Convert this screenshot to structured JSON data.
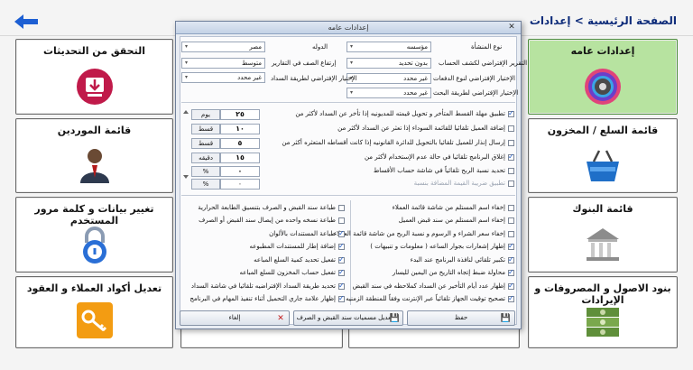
{
  "header": {
    "breadcrumb": "الصفحة الرئيسية > إعدادات"
  },
  "tiles": {
    "updates": "التحقق من التحديثات",
    "general": "إعدادات عامه",
    "suppliers": "قائمة الموردين",
    "goods": "قائمة السلع / المخزون",
    "user": "تغيير بيانات و كلمة مرور المستخدم",
    "banks": "قائمة البنوك",
    "codes": "تعديل أكواد العملاء و العقود",
    "assets": "بنود الاصول و المصروفات و الإيرادات"
  },
  "dialog": {
    "title": "إعدادات عامه",
    "fields": {
      "entity_type_label": "نوع المنشأة",
      "entity_type_value": "مؤسسه",
      "country_label": "الدوله",
      "country_value": "مصر",
      "default_report_label": "التقرير الإفتراضي لكشف الحساب",
      "default_report_value": "بدون تحديد",
      "row_height_label": "إرتفاع الصف في التقارير",
      "row_height_value": "متوسط",
      "payment_type_label": "الإختيار الإفتراضي لنوع الدفعات",
      "payment_type_value": "غير محدد",
      "payment_method_label": "الإختيار الإفتراضي لطريقة السداد",
      "payment_method_value": "غير محدد",
      "search_method_label": "الإختيار الإفتراضي لطريقة البحث",
      "search_method_value": "غير محدد"
    },
    "options_top": [
      {
        "label": "تطبيق مهلة القسط المتأخر و تحويل قيمته للمديونيه إذا تأخر عن السداد لأكثر من",
        "value": "٢٥",
        "unit": "يوم"
      },
      {
        "label": "إضافة العميل تلقائيا للقائمة السوداء إذا تعثر عن السداد لأكثر من",
        "value": "١٠",
        "unit": "قسط"
      },
      {
        "label": "إرسال إنذار للعميل تلقائيا بالتحويل للدائرة القانونيه إذا كانت أقساطه المتعثره أكثر من",
        "value": "٥",
        "unit": "قسط"
      },
      {
        "label": "إغلاق البرنامج تلقائيا في حالة عدم الإستخدام لأكثر من",
        "value": "١٥",
        "unit": "دقيقه"
      },
      {
        "label": "تحديد نسبة الربح تلقائياً في شاشة حساب الأقساط",
        "value": "٠",
        "unit": "%"
      },
      {
        "label": "تطبيق ضريبة القيمة المضافة بنسبة",
        "value": "٠",
        "unit": "%"
      }
    ],
    "options_left": [
      "طباعة سند القبض و الصرف بتنسيق الطابعة الحرارية",
      "طباعة نسخه واحده من إيصال سند القبض أو الصرف",
      "طباعة المستندات بالألوان",
      "إضافة إطار للمستندات المطبوعه",
      "تفعيل تحديد كمية السلع المباعه",
      "تفعيل حساب المخزون للسلع المباعه",
      "تحديد طريقة السداد الإفتراضيه تلقائيا في شاشة السداد",
      "إظهار علامة جاري التحميل أثناء تنفيذ المهام في البرنامج"
    ],
    "options_right": [
      "إخفاء اسم المستلم من شاشة قائمة العملاء",
      "إخفاء اسم المستلم من سند قبض العميل",
      "إخفاء سعر الشراء و الرسوم و نسبة الربح من شاشة قائمة العملاء",
      "إظهار إشعارات بجوار الساعه ( معلومات و تنبيهات )",
      "تكبير تلقائي لنافذة البرنامج عند البدء",
      "محاولة ضبط إتجاه التاريخ من اليمين لليسار",
      "إظهار عدد أيام التأخير عن السداد كملاحظه في سند القبض",
      "تصحيح توقيت الجهاز تلقائياً عبر الإنترنت وفقاً للمنطقة الزمنيه"
    ],
    "buttons": {
      "save": "حفظ",
      "edit_names": "تعديل مسميات سند القبض و الصرف",
      "cancel": "إلغاء"
    }
  }
}
